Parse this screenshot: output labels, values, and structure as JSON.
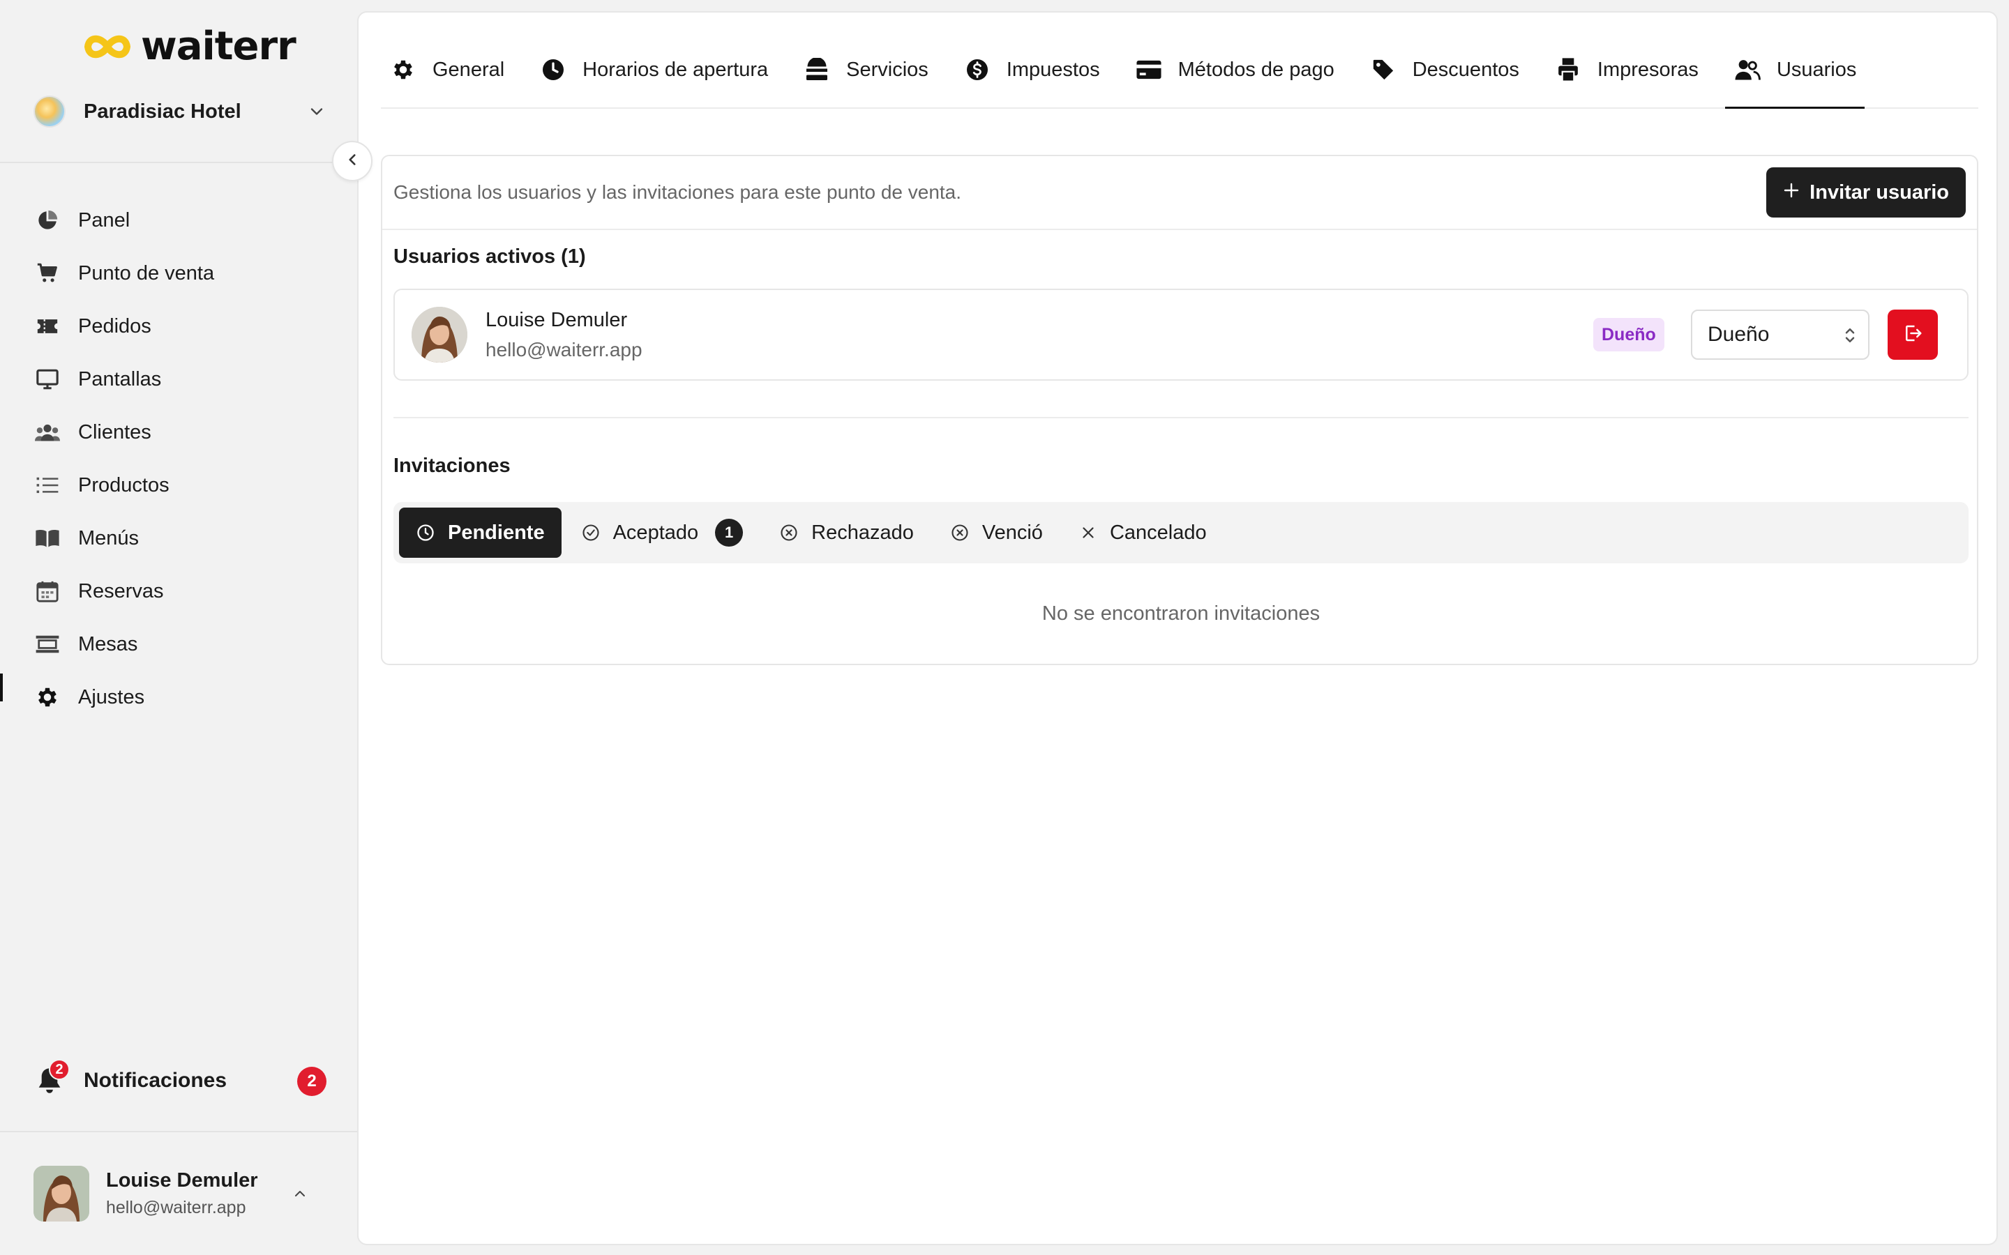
{
  "brand": {
    "name": "waiterr"
  },
  "venue": {
    "name": "Paradisiac Hotel"
  },
  "sidebar": {
    "items": [
      {
        "label": "Panel",
        "icon": "pie-chart-icon"
      },
      {
        "label": "Punto de venta",
        "icon": "cart-icon"
      },
      {
        "label": "Pedidos",
        "icon": "ticket-icon"
      },
      {
        "label": "Pantallas",
        "icon": "monitor-icon"
      },
      {
        "label": "Clientes",
        "icon": "users-icon"
      },
      {
        "label": "Productos",
        "icon": "list-icon"
      },
      {
        "label": "Menús",
        "icon": "book-icon"
      },
      {
        "label": "Reservas",
        "icon": "calendar-icon"
      },
      {
        "label": "Mesas",
        "icon": "table-icon"
      },
      {
        "label": "Ajustes",
        "icon": "gear-icon"
      }
    ],
    "active": "Ajustes"
  },
  "notifications": {
    "label": "Notificaciones",
    "badge": "2",
    "count": "2"
  },
  "user": {
    "name": "Louise Demuler",
    "email": "hello@waiterr.app"
  },
  "tabs": [
    {
      "label": "General",
      "icon": "gear-icon"
    },
    {
      "label": "Horarios de apertura",
      "icon": "clock-icon"
    },
    {
      "label": "Servicios",
      "icon": "service-icon"
    },
    {
      "label": "Impuestos",
      "icon": "dollar-circle-icon"
    },
    {
      "label": "Métodos de pago",
      "icon": "credit-card-icon"
    },
    {
      "label": "Descuentos",
      "icon": "tag-icon"
    },
    {
      "label": "Impresoras",
      "icon": "printer-icon"
    },
    {
      "label": "Usuarios",
      "icon": "users-icon"
    }
  ],
  "active_tab": "Usuarios",
  "users_page": {
    "description": "Gestiona los usuarios y las invitaciones para este punto de venta.",
    "invite_button": "Invitar usuario",
    "active_title": "Usuarios activos (1)",
    "members": [
      {
        "name": "Louise Demuler",
        "email": "hello@waiterr.app",
        "badge": "Dueño",
        "role": "Dueño"
      }
    ],
    "invitations_title": "Invitaciones",
    "filters": [
      {
        "label": "Pendiente",
        "icon": "clock-icon",
        "active": true
      },
      {
        "label": "Aceptado",
        "icon": "check-circle-icon",
        "count": "1"
      },
      {
        "label": "Rechazado",
        "icon": "x-circle-icon"
      },
      {
        "label": "Venció",
        "icon": "x-circle-icon"
      },
      {
        "label": "Cancelado",
        "icon": "x-icon"
      }
    ],
    "empty_text": "No se encontraron invitaciones"
  },
  "colors": {
    "accent": "#1f1f1f",
    "danger": "#e30f1f",
    "badge_bg": "#f3e3fb",
    "badge_text": "#8a2bc4",
    "logo_yellow": "#f5c518"
  }
}
